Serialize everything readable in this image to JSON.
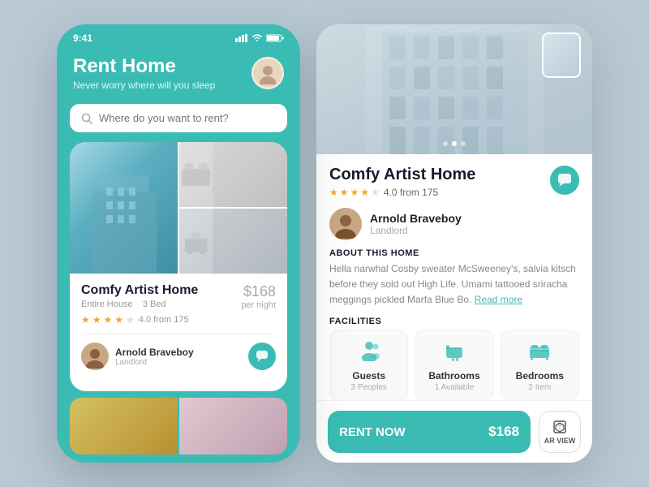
{
  "left_phone": {
    "status_time": "9:41",
    "header_title": "Rent Home",
    "header_subtitle": "Never worry where will you sleep",
    "search_placeholder": "Where do you want to rent?",
    "card": {
      "title": "Comfy Artist Home",
      "type": "Entire House",
      "beds": "3 Bed",
      "price": "$168",
      "price_unit": "per night",
      "rating": "4.0 from 175",
      "stars": 4,
      "landlord_name": "Arnold Braveboy",
      "landlord_role": "Landlord"
    }
  },
  "right_panel": {
    "title": "Comfy Artist Home",
    "rating": "4.0 from 175",
    "stars": 4,
    "landlord_name": "Arnold Braveboy",
    "landlord_role": "Landlord",
    "about_label": "ABOUT THIS HOME",
    "about_text": "Hella narwhal Cosby sweater McSweeney's, salvia kitsch before they sold out High Life. Umami tattooed sriracha meggings pickled Marfa Blue Bo.",
    "read_more": "Read more",
    "facilities_label": "FACILITIES",
    "facilities": [
      {
        "name": "Guests",
        "detail": "3 Peoples",
        "icon": "👤"
      },
      {
        "name": "Bathrooms",
        "detail": "1 Available",
        "icon": "🛁"
      },
      {
        "name": "Bedrooms",
        "detail": "2 Item",
        "icon": "🛏"
      }
    ],
    "rent_label": "RENT NOW",
    "rent_price": "$168",
    "ar_label": "AR VIEW"
  }
}
